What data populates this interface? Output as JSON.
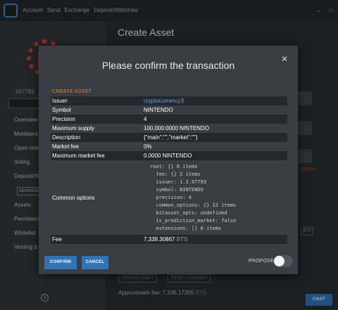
{
  "nav": {
    "items": [
      "Account",
      "Send",
      "Exchange",
      "Deposit/Withdraw"
    ]
  },
  "sidebar": {
    "account_id": "#97793",
    "items": [
      "Overview",
      "Members",
      "Open orders",
      "Voting",
      "Deposit/W"
    ],
    "advanced_label": "ADVANCED",
    "items2": [
      "Assets",
      "Permissions",
      "Whitelist",
      "Vesting b"
    ]
  },
  "main": {
    "title": "Create Asset",
    "approx_fee_label": "Approximate fee:",
    "approx_fee_value": "7,336.17395",
    "approx_fee_unit": "BTS",
    "chat_label": "CHAT"
  },
  "modal": {
    "title": "Please confirm the transaction",
    "section_label": "CREATE ASSET",
    "rows": {
      "issuer_key": "Issuer",
      "issuer_value": "cryptocurrency3",
      "symbol_key": "Symbol",
      "symbol_value": "NINTENDO",
      "precision_key": "Precision",
      "precision_value": "4",
      "max_supply_key": "Maximum supply",
      "max_supply_value": "100,000.0000 NINTENDO",
      "description_key": "Description",
      "description_value": "{\"main\":\"\",\"market\":\"\"}",
      "market_fee_key": "Market fee",
      "market_fee_value": "0%",
      "max_market_fee_key": "Maximum market fee",
      "max_market_fee_value": "0.0000 NINTENDO",
      "common_options_key": "Common options",
      "fee_key": "Fee",
      "fee_value": "7,338.30867",
      "fee_unit": "BTS"
    },
    "common_options_lines": [
      "root: {} 8 items",
      "  fee: {} 2 items",
      "  issuer: 1.2.97793",
      "  symbol: NINTENDO",
      "  precision: 4",
      "  common_options: {} 12 items",
      "  bitasset_opts: undefined",
      "  is_prediction_market: false",
      "  extensions: [] 0 items"
    ],
    "confirm_label": "CONFIRM",
    "cancel_label": "CANCEL",
    "propose_label": "PROPOSE:",
    "propose_enabled": false
  }
}
